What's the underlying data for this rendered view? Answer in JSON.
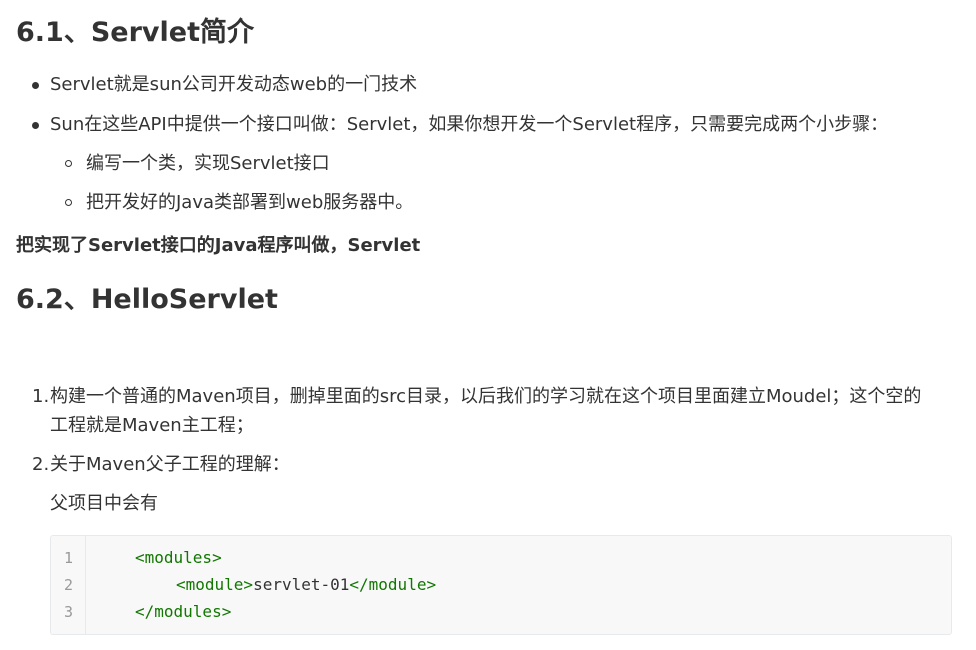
{
  "headings": {
    "h1": "6.1、Servlet简介",
    "h2": "6.2、HelloServlet"
  },
  "intro_list": [
    "Servlet就是sun公司开发动态web的一门技术",
    "Sun在这些API中提供一个接口叫做：Servlet，如果你想开发一个Servlet程序，只需要完成两个小步骤："
  ],
  "sub_list": [
    "编写一个类，实现Servlet接口",
    "把开发好的Java类部署到web服务器中。"
  ],
  "bold_note": "把实现了Servlet接口的Java程序叫做，Servlet",
  "ordered_list": [
    {
      "num": "1.",
      "line1": "构建一个普通的Maven项目，删掉里面的src目录，以后我们的学习就在这个项目里面建立Moudel；这个空的",
      "line2": "工程就是Maven主工程；"
    },
    {
      "num": "2.",
      "line1": "关于Maven父子工程的理解："
    }
  ],
  "parent_note": "父项目中会有",
  "code": {
    "line_numbers": [
      "1",
      "2",
      "3"
    ],
    "lines": [
      {
        "open": "<modules>"
      },
      {
        "open": "<module>",
        "text": "servlet-01",
        "close": "</module>"
      },
      {
        "open": "</modules>"
      }
    ]
  }
}
